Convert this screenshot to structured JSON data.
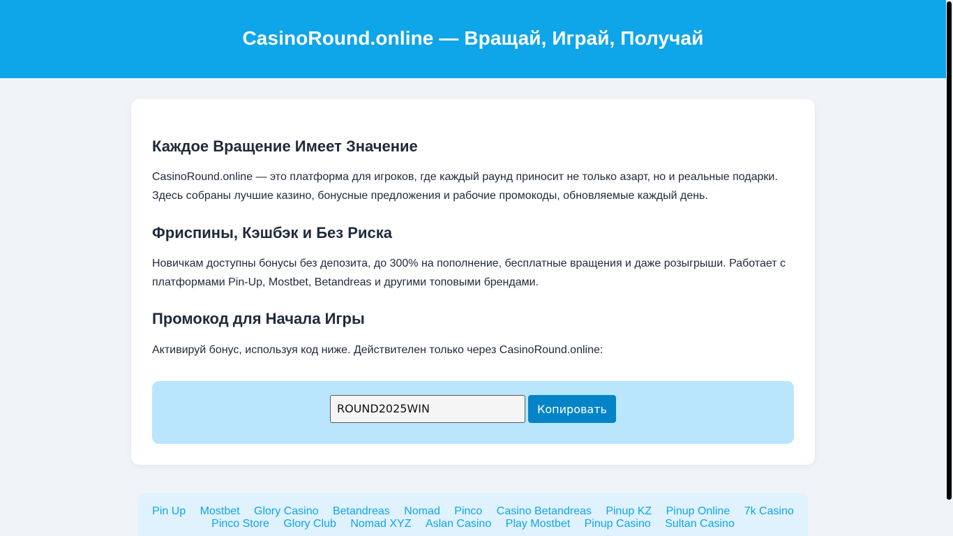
{
  "header": {
    "title": "CasinoRound.online — Вращай, Играй, Получай"
  },
  "content": {
    "section1": {
      "heading": "Каждое Вращение Имеет Значение",
      "text": "CasinoRound.online — это платформа для игроков, где каждый раунд приносит не только азарт, но и реальные подарки. Здесь собраны лучшие казино, бонусные предложения и рабочие промокоды, обновляемые каждый день."
    },
    "section2": {
      "heading": "Фриспины, Кэшбэк и Без Риска",
      "text": "Новичкам доступны бонусы без депозита, до 300% на пополнение, бесплатные вращения и даже розыгрыши. Работает с платформами Pin-Up, Mostbet, Betandreas и другими топовыми брендами."
    },
    "section3": {
      "heading": "Промокод для Начала Игры",
      "text": "Активируй бонус, используя код ниже. Действителен только через CasinoRound.online:"
    }
  },
  "promo": {
    "code_value": "ROUND2025WIN",
    "copy_label": "Копировать"
  },
  "footer_links": [
    "Pin Up",
    "Mostbet",
    "Glory Casino",
    "Betandreas",
    "Nomad",
    "Pinco",
    "Casino Betandreas",
    "Pinup KZ",
    "Pinup Online",
    "7k Casino",
    "Pinco Store",
    "Glory Club",
    "Nomad XYZ",
    "Aslan Casino",
    "Play Mostbet",
    "Pinup Casino",
    "Sultan Casino"
  ],
  "colors": {
    "header_bg": "#0ea5e9",
    "accent_button": "#0284c7",
    "promo_bg": "#bae6fd",
    "link_color": "#0ea5e9"
  }
}
